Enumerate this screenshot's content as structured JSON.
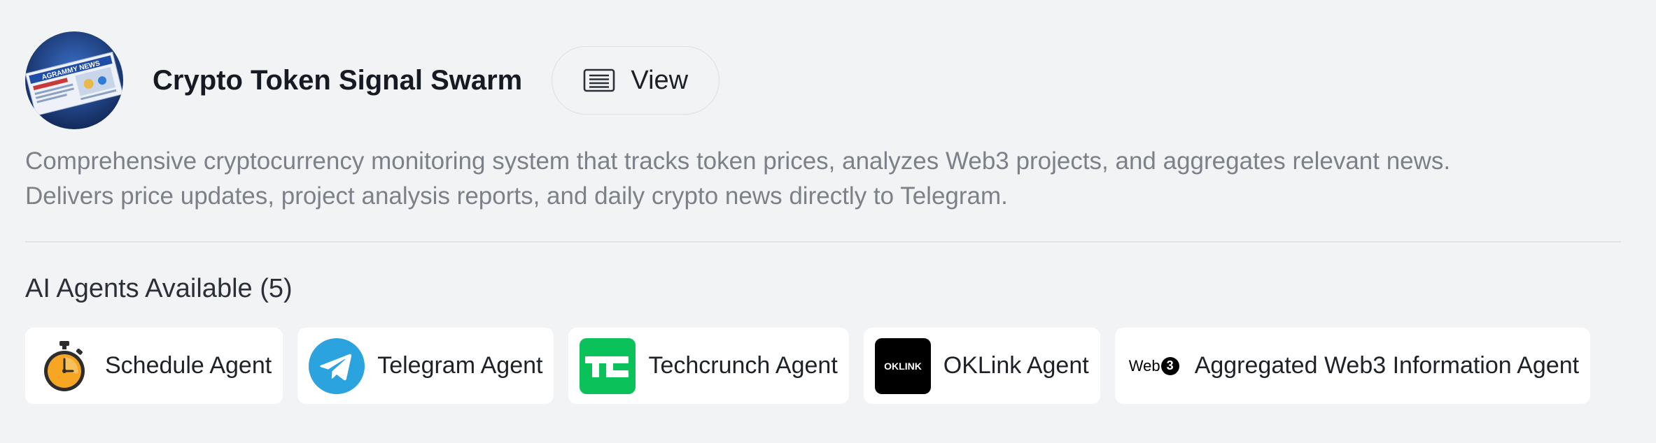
{
  "swarm": {
    "title": "Crypto Token Signal Swarm",
    "view_label": "View",
    "description_line1": "Comprehensive cryptocurrency monitoring system that tracks token prices, analyzes Web3 projects, and aggregates relevant news.",
    "description_line2": "Delivers price updates, project analysis reports, and daily crypto news directly to Telegram.",
    "avatar_text": "AGRAMMY NEWS"
  },
  "agents_section": {
    "title": "AI Agents Available (5)",
    "agents": [
      {
        "label": "Schedule Agent",
        "icon": "stopwatch-icon"
      },
      {
        "label": "Telegram Agent",
        "icon": "telegram-icon"
      },
      {
        "label": "Techcrunch Agent",
        "icon": "techcrunch-icon"
      },
      {
        "label": "OKLink Agent",
        "icon": "oklink-icon"
      },
      {
        "label": "Aggregated Web3 Information Agent",
        "icon": "web3-icon",
        "logo_text": "Web",
        "logo_badge": "3"
      }
    ]
  },
  "logos": {
    "techcrunch_text": "TC",
    "oklink_text": "OKLINK"
  },
  "colors": {
    "background": "#f2f3f5",
    "telegram": "#2aa3df",
    "techcrunch": "#0ac15a",
    "stopwatch": "#f6a623"
  }
}
